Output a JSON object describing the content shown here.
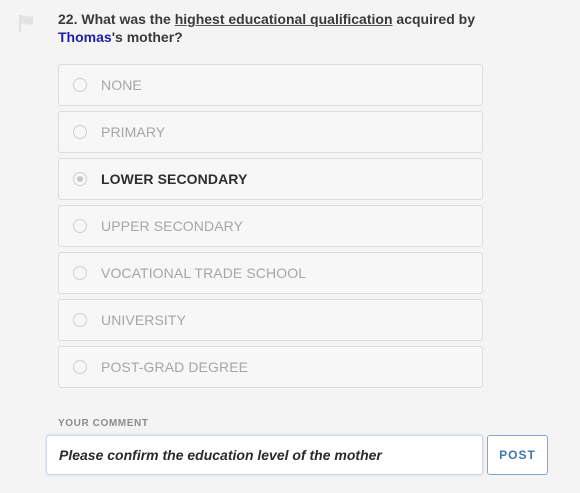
{
  "question": {
    "number_prefix": "22. What was the ",
    "underlined_text": "highest educational qualification",
    "mid_text": " acquired by",
    "person_name": "Thomas",
    "suffix": "'s mother?"
  },
  "options": [
    {
      "label": "NONE",
      "selected": false
    },
    {
      "label": "PRIMARY",
      "selected": false
    },
    {
      "label": "LOWER SECONDARY",
      "selected": true
    },
    {
      "label": "UPPER SECONDARY",
      "selected": false
    },
    {
      "label": "VOCATIONAL TRADE SCHOOL",
      "selected": false
    },
    {
      "label": "UNIVERSITY",
      "selected": false
    },
    {
      "label": "POST-GRAD DEGREE",
      "selected": false
    }
  ],
  "comment": {
    "label": "YOUR COMMENT",
    "value": "Please confirm the education level of the mother"
  },
  "post_button": {
    "label": "POST"
  },
  "icons": {
    "flag": "flag-icon"
  },
  "colors": {
    "name_link": "#1f1fa8",
    "post_button": "#3f77b5"
  }
}
